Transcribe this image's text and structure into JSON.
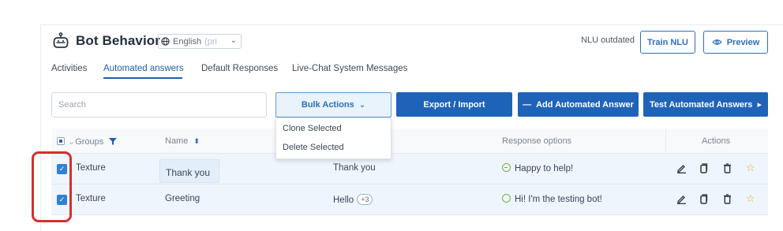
{
  "header": {
    "title": "Bot Behavior",
    "language_value": "English",
    "language_suffix": "(pri",
    "nlu_status": "NLU outdated",
    "train_label": "Train NLU",
    "preview_label": "Preview"
  },
  "tabs": [
    {
      "label": "Activities"
    },
    {
      "label": "Automated answers"
    },
    {
      "label": "Default Responses"
    },
    {
      "label": "Live-Chat System Messages"
    }
  ],
  "toolbar": {
    "search_placeholder": "Search",
    "bulk_label": "Bulk Actions",
    "export_label": "Export / Import",
    "add_label": "Add Automated Answer",
    "add_prefix": "—",
    "test_label": "Test Automated Answers",
    "test_suffix": "▸"
  },
  "bulk_menu": {
    "items": [
      "Clone Selected",
      "Delete Selected"
    ]
  },
  "table": {
    "columns": {
      "groups": "Groups",
      "name": "Name",
      "response_options": "Response options",
      "actions": "Actions"
    },
    "rows": [
      {
        "group": "Texture",
        "name": "Thank you",
        "example": "Thank you",
        "example_extra": "",
        "response": "Happy to help!",
        "checked": true
      },
      {
        "group": "Texture",
        "name": "Greeting",
        "example": "Hello",
        "example_extra": "+3",
        "response": "Hi! I'm the testing bot!",
        "checked": true
      }
    ]
  },
  "colors": {
    "primary": "#1f63b9",
    "accent_text": "#2d6fc0",
    "highlight_border": "#d62f2f",
    "star": "#f3a925",
    "response_icon": "#7fb23c"
  },
  "icons": [
    "robot-icon",
    "globe-icon",
    "chevron-down-icon",
    "eye-icon",
    "filter-icon",
    "sort-icon",
    "edit-icon",
    "copy-icon",
    "delete-icon",
    "star-icon",
    "checkbox-icon",
    "chevron-right-icon"
  ]
}
